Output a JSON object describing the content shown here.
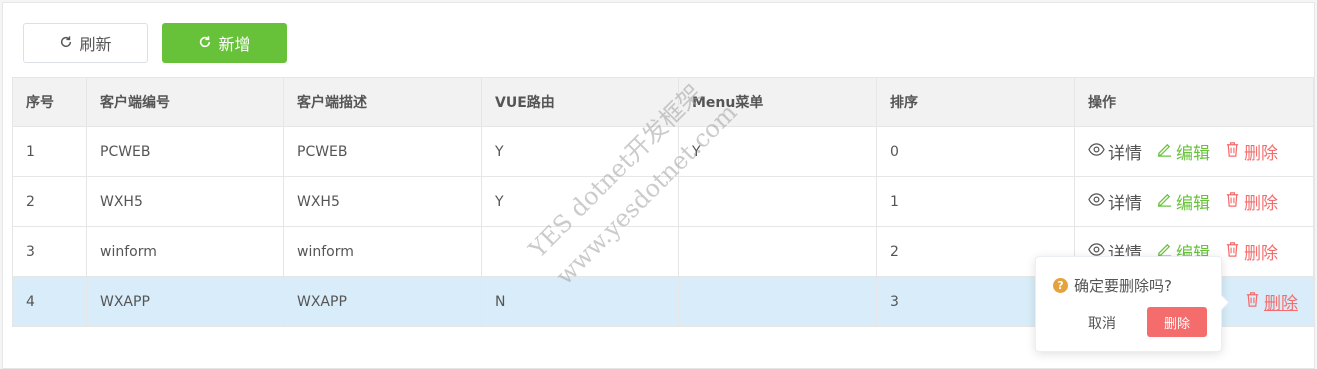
{
  "toolbar": {
    "refresh_label": "刷新",
    "add_label": "新增"
  },
  "table": {
    "headers": [
      "序号",
      "客户端编号",
      "客户端描述",
      "VUE路由",
      "Menu菜单",
      "排序",
      "操作"
    ],
    "rows": [
      {
        "index": "1",
        "code": "PCWEB",
        "desc": "PCWEB",
        "vue": "Y",
        "menu": "Y",
        "sort": "0"
      },
      {
        "index": "2",
        "code": "WXH5",
        "desc": "WXH5",
        "vue": "Y",
        "menu": "",
        "sort": "1"
      },
      {
        "index": "3",
        "code": "winform",
        "desc": "winform",
        "vue": "",
        "menu": "",
        "sort": "2"
      },
      {
        "index": "4",
        "code": "WXAPP",
        "desc": "WXAPP",
        "vue": "N",
        "menu": "",
        "sort": "3"
      }
    ],
    "actions": {
      "detail": "详情",
      "edit": "编辑",
      "delete": "删除"
    }
  },
  "popconfirm": {
    "question": "确定要删除吗?",
    "cancel": "取消",
    "confirm": "删除"
  },
  "watermark": {
    "line1": "YES dotnet开发框架",
    "line2": "www.yesdotnet.com"
  },
  "colors": {
    "primary": "#67c23a",
    "danger": "#f56c6c",
    "warning": "#e6a23c",
    "row_highlight": "#d8edf9"
  }
}
